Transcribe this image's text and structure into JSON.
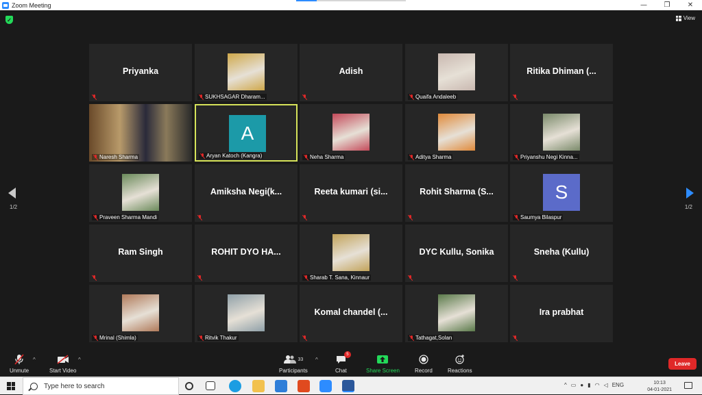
{
  "window": {
    "title": "Zoom Meeting",
    "minimize": "—",
    "restore": "❐",
    "close": "✕"
  },
  "header": {
    "view_label": "View"
  },
  "pagination": {
    "left": "1/2",
    "right": "1/2"
  },
  "tiles": [
    {
      "name": "Priyanka",
      "label": "",
      "type": "name"
    },
    {
      "name": "",
      "label": "SUKHSAGAR Dharam...",
      "type": "photo",
      "color": "#cfa84a"
    },
    {
      "name": "Adish",
      "label": "",
      "type": "name"
    },
    {
      "name": "",
      "label": "Quaifa Andaleeb",
      "type": "photo",
      "color": "#c9b8b0"
    },
    {
      "name": "Ritika Dhiman (...",
      "label": "",
      "type": "name"
    },
    {
      "name": "",
      "label": "Naresh Sharma",
      "type": "video",
      "color": "#8a5a3a"
    },
    {
      "name": "",
      "label": "Aryan Katoch (Kangra)",
      "type": "avatar",
      "letter": "A",
      "color": "#1c9aa8",
      "active": true
    },
    {
      "name": "",
      "label": "Neha Sharma",
      "type": "photo",
      "color": "#c44a5a"
    },
    {
      "name": "",
      "label": "Aditya Sharma",
      "type": "photo",
      "color": "#e08a3a"
    },
    {
      "name": "",
      "label": "Priyanshu Negi Kinna...",
      "type": "photo",
      "color": "#7a8a6a"
    },
    {
      "name": "",
      "label": "Praveen Sharma Mandi",
      "type": "photo",
      "color": "#6a8a5a"
    },
    {
      "name": "Amiksha Negi(k...",
      "label": "",
      "type": "name"
    },
    {
      "name": "Reeta kumari (si...",
      "label": "",
      "type": "name"
    },
    {
      "name": "Rohit Sharma (S...",
      "label": "",
      "type": "name"
    },
    {
      "name": "",
      "label": "Saumya Bilaspur",
      "type": "avatar",
      "letter": "S",
      "color": "#5b6bc9"
    },
    {
      "name": "Ram Singh",
      "label": "",
      "type": "name"
    },
    {
      "name": "ROHIT DYO HA...",
      "label": "",
      "type": "name"
    },
    {
      "name": "",
      "label": "Sharab T. Sana, Kinnaur",
      "type": "photo",
      "color": "#c2a35a"
    },
    {
      "name": "DYC Kullu, Sonika",
      "label": "",
      "type": "name"
    },
    {
      "name": "Sneha (Kullu)",
      "label": "",
      "type": "name"
    },
    {
      "name": "",
      "label": "Mrinal (Shimla)",
      "type": "photo",
      "color": "#b07a5a"
    },
    {
      "name": "",
      "label": "Ritvik Thakur",
      "type": "photo",
      "color": "#8fa0a8"
    },
    {
      "name": "Komal chandel (...",
      "label": "",
      "type": "name"
    },
    {
      "name": "",
      "label": "Tathagat,Solan",
      "type": "photo",
      "color": "#5a7a4a"
    },
    {
      "name": "Ira prabhat",
      "label": "",
      "type": "name"
    }
  ],
  "toolbar": {
    "unmute": "Unmute",
    "start_video": "Start Video",
    "participants": "Participants",
    "participants_count": "33",
    "chat": "Chat",
    "chat_badge": "5",
    "share_screen": "Share Screen",
    "record": "Record",
    "reactions": "Reactions",
    "leave": "Leave"
  },
  "taskbar": {
    "search_placeholder": "Type here to search",
    "lang": "ENG",
    "time": "10:13",
    "date": "04-01-2021"
  },
  "colors": {
    "accent": "#2d8cff",
    "leave": "#e02828",
    "share": "#23d959",
    "active_border": "#d7e45a"
  }
}
